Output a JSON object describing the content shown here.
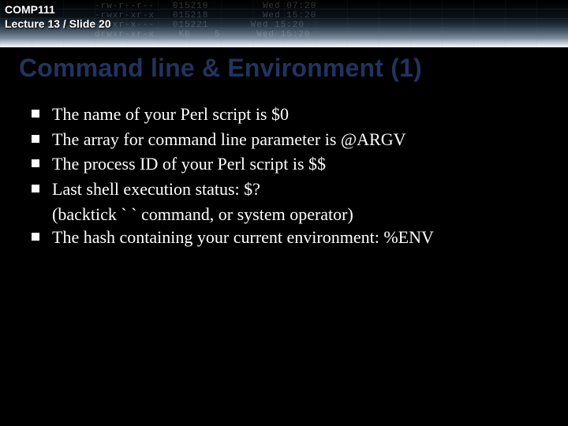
{
  "course": "COMP111",
  "slide_ref": "Lecture 13 / Slide 20",
  "title": "Command line & Environment (1)",
  "bullets": [
    {
      "text": "The name of your Perl script is $0"
    },
    {
      "text": "The array for command line parameter is @ARGV"
    },
    {
      "text": "The process ID of your Perl script is $$"
    },
    {
      "text": "Last shell execution status: $?",
      "cont": "(backtick ` ` command, or system operator)"
    },
    {
      "text": "The hash containing your current environment: %ENV"
    }
  ],
  "ghost_lines": [
    "-rw-r--r--   015210         Wed 07:20",
    "-rwxr-xr-x   015218         Wed 15:20",
    "-rwxr-x---   015221       Wed 15:20",
    "drwxr-xr-x    KB    5      Wed 15:20"
  ]
}
